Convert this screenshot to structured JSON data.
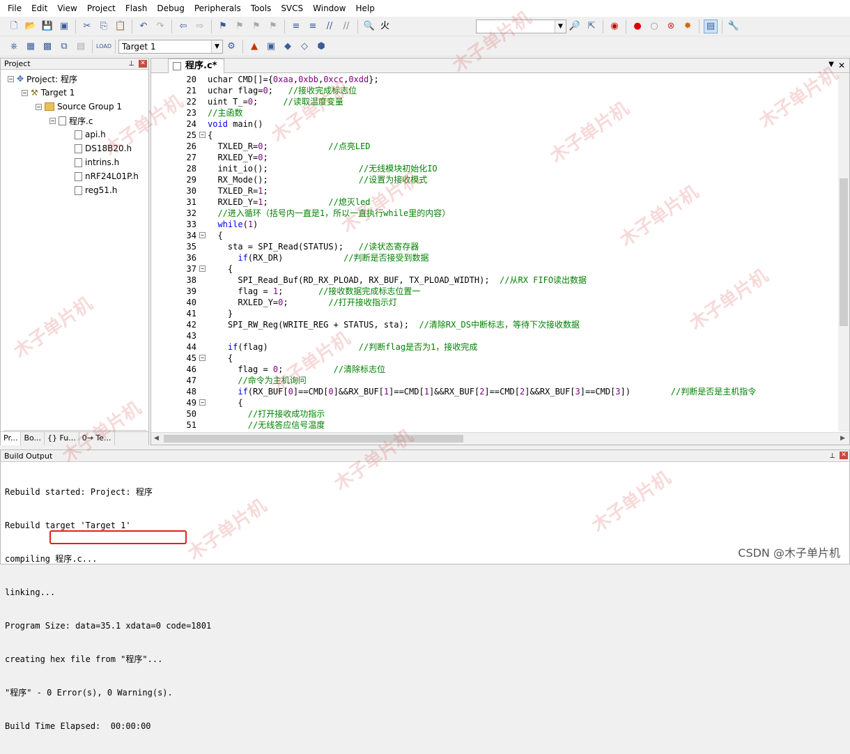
{
  "menu": [
    "File",
    "Edit",
    "View",
    "Project",
    "Flash",
    "Debug",
    "Peripherals",
    "Tools",
    "SVCS",
    "Window",
    "Help"
  ],
  "toolbar1": {
    "search_text": "火"
  },
  "toolbar2": {
    "target": "Target 1"
  },
  "project": {
    "title": "Project",
    "root": "Project: 程序",
    "target": "Target 1",
    "group": "Source Group 1",
    "file": "程序.c",
    "headers": [
      "api.h",
      "DS18B20.h",
      "intrins.h",
      "nRF24L01P.h",
      "reg51.h"
    ],
    "tabs": [
      "Pr...",
      "Bo...",
      "{} Fu...",
      "0→ Te..."
    ]
  },
  "editor": {
    "tab": "程序.c*",
    "lines": [
      {
        "n": "20",
        "fold": "",
        "segs": [
          [
            "",
            "uchar CMD[]={"
          ],
          [
            "num",
            "0xaa"
          ],
          [
            "",
            ","
          ],
          [
            "num",
            "0xbb"
          ],
          [
            "",
            ","
          ],
          [
            "num",
            "0xcc"
          ],
          [
            "",
            ","
          ],
          [
            "num",
            "0xdd"
          ],
          [
            "",
            "};"
          ]
        ]
      },
      {
        "n": "21",
        "fold": "",
        "segs": [
          [
            "",
            "uchar flag="
          ],
          [
            "num",
            "0"
          ],
          [
            "",
            ";   "
          ],
          [
            "cm",
            "//接收完成标志位"
          ]
        ]
      },
      {
        "n": "22",
        "fold": "",
        "segs": [
          [
            "",
            "uint T_="
          ],
          [
            "num",
            "0"
          ],
          [
            "",
            ";     "
          ],
          [
            "cm",
            "//读取温度变量"
          ]
        ]
      },
      {
        "n": "23",
        "fold": "",
        "segs": [
          [
            "cm",
            "//主函数"
          ]
        ]
      },
      {
        "n": "24",
        "fold": "",
        "segs": [
          [
            "kw",
            "void"
          ],
          [
            "",
            " main()"
          ]
        ]
      },
      {
        "n": "25",
        "fold": "−",
        "segs": [
          [
            "",
            "{"
          ]
        ]
      },
      {
        "n": "26",
        "fold": "",
        "segs": [
          [
            "",
            "  TXLED_R="
          ],
          [
            "num",
            "0"
          ],
          [
            "",
            ";            "
          ],
          [
            "cm",
            "//点亮LED"
          ]
        ]
      },
      {
        "n": "27",
        "fold": "",
        "segs": [
          [
            "",
            "  RXLED_Y="
          ],
          [
            "num",
            "0"
          ],
          [
            "",
            ";"
          ]
        ]
      },
      {
        "n": "28",
        "fold": "",
        "segs": [
          [
            "",
            "  init_io();                  "
          ],
          [
            "cm",
            "//无线模块初始化IO"
          ]
        ]
      },
      {
        "n": "29",
        "fold": "",
        "segs": [
          [
            "",
            "  RX_Mode();                  "
          ],
          [
            "cm",
            "//设置为接收模式"
          ]
        ]
      },
      {
        "n": "30",
        "fold": "",
        "segs": [
          [
            "",
            "  TXLED_R="
          ],
          [
            "num",
            "1"
          ],
          [
            "",
            ";"
          ]
        ]
      },
      {
        "n": "31",
        "fold": "",
        "segs": [
          [
            "",
            "  RXLED_Y="
          ],
          [
            "num",
            "1"
          ],
          [
            "",
            ";            "
          ],
          [
            "cm",
            "//熄灭led"
          ]
        ]
      },
      {
        "n": "32",
        "fold": "",
        "segs": [
          [
            "cm",
            "  //进入循环（括号内一直是1，所以一直执行while里的内容）"
          ]
        ]
      },
      {
        "n": "33",
        "fold": "",
        "segs": [
          [
            "kw",
            "  while"
          ],
          [
            "",
            "("
          ],
          [
            "num",
            "1"
          ],
          [
            "",
            ")"
          ]
        ]
      },
      {
        "n": "34",
        "fold": "−",
        "segs": [
          [
            "",
            "  {"
          ]
        ]
      },
      {
        "n": "35",
        "fold": "",
        "segs": [
          [
            "",
            "    sta = SPI_Read(STATUS);   "
          ],
          [
            "cm",
            "//读状态寄存器"
          ]
        ]
      },
      {
        "n": "36",
        "fold": "",
        "segs": [
          [
            "kw",
            "      if"
          ],
          [
            "",
            "(RX_DR)            "
          ],
          [
            "cm",
            "//判断是否接受到数据"
          ]
        ]
      },
      {
        "n": "37",
        "fold": "−",
        "segs": [
          [
            "",
            "    {"
          ]
        ]
      },
      {
        "n": "38",
        "fold": "",
        "segs": [
          [
            "",
            "      SPI_Read_Buf(RD_RX_PLOAD, RX_BUF, TX_PLOAD_WIDTH);  "
          ],
          [
            "cm",
            "//从RX FIFO读出数据"
          ]
        ]
      },
      {
        "n": "39",
        "fold": "",
        "segs": [
          [
            "",
            "      flag = "
          ],
          [
            "num",
            "1"
          ],
          [
            "",
            ";       "
          ],
          [
            "cm",
            "//接收数据完成标志位置一"
          ]
        ]
      },
      {
        "n": "40",
        "fold": "",
        "segs": [
          [
            "",
            "      RXLED_Y="
          ],
          [
            "num",
            "0"
          ],
          [
            "",
            ";        "
          ],
          [
            "cm",
            "//打开接收指示灯"
          ]
        ]
      },
      {
        "n": "41",
        "fold": "",
        "segs": [
          [
            "",
            "    }"
          ]
        ]
      },
      {
        "n": "42",
        "fold": "",
        "segs": [
          [
            "",
            "    SPI_RW_Reg(WRITE_REG + STATUS, sta);  "
          ],
          [
            "cm",
            "//清除RX_DS中断标志，等待下次接收数据"
          ]
        ]
      },
      {
        "n": "43",
        "fold": "",
        "segs": [
          [
            "",
            ""
          ]
        ]
      },
      {
        "n": "44",
        "fold": "",
        "segs": [
          [
            "kw",
            "    if"
          ],
          [
            "",
            "(flag)                  "
          ],
          [
            "cm",
            "//判断flag是否为1，接收完成"
          ]
        ]
      },
      {
        "n": "45",
        "fold": "−",
        "segs": [
          [
            "",
            "    {"
          ]
        ]
      },
      {
        "n": "46",
        "fold": "",
        "segs": [
          [
            "",
            "      flag = "
          ],
          [
            "num",
            "0"
          ],
          [
            "",
            ";          "
          ],
          [
            "cm",
            "//清除标志位"
          ]
        ]
      },
      {
        "n": "47",
        "fold": "",
        "segs": [
          [
            "cm",
            "      //命令为主机询问"
          ]
        ]
      },
      {
        "n": "48",
        "fold": "",
        "segs": [
          [
            "kw",
            "      if"
          ],
          [
            "",
            "(RX_BUF["
          ],
          [
            "num",
            "0"
          ],
          [
            "",
            "]==CMD["
          ],
          [
            "num",
            "0"
          ],
          [
            "",
            "]&&RX_BUF["
          ],
          [
            "num",
            "1"
          ],
          [
            "",
            "]==CMD["
          ],
          [
            "num",
            "1"
          ],
          [
            "",
            "]&&RX_BUF["
          ],
          [
            "num",
            "2"
          ],
          [
            "",
            "]==CMD["
          ],
          [
            "num",
            "2"
          ],
          [
            "",
            "]&&RX_BUF["
          ],
          [
            "num",
            "3"
          ],
          [
            "",
            "]==CMD["
          ],
          [
            "num",
            "3"
          ],
          [
            "",
            "])        "
          ],
          [
            "cm",
            "//判断是否是主机指令"
          ]
        ]
      },
      {
        "n": "49",
        "fold": "−",
        "segs": [
          [
            "",
            "      {"
          ]
        ]
      },
      {
        "n": "50",
        "fold": "",
        "segs": [
          [
            "cm",
            "        //打开接收成功指示"
          ]
        ]
      },
      {
        "n": "51",
        "fold": "",
        "segs": [
          [
            "cm",
            "        //无线答应信号温度"
          ]
        ]
      }
    ]
  },
  "build": {
    "title": "Build Output",
    "lines": [
      "Rebuild started: Project: 程序",
      "Rebuild target 'Target 1'",
      "compiling 程序.c...",
      "linking...",
      "Program Size: data=35.1 xdata=0 code=1801",
      "creating hex file from \"程序\"...",
      "\"程序\" - 0 Error(s), 0 Warning(s).",
      "Build Time Elapsed:  00:00:00"
    ]
  },
  "watermark": "木子单片机",
  "csdn": "CSDN @木子单片机"
}
